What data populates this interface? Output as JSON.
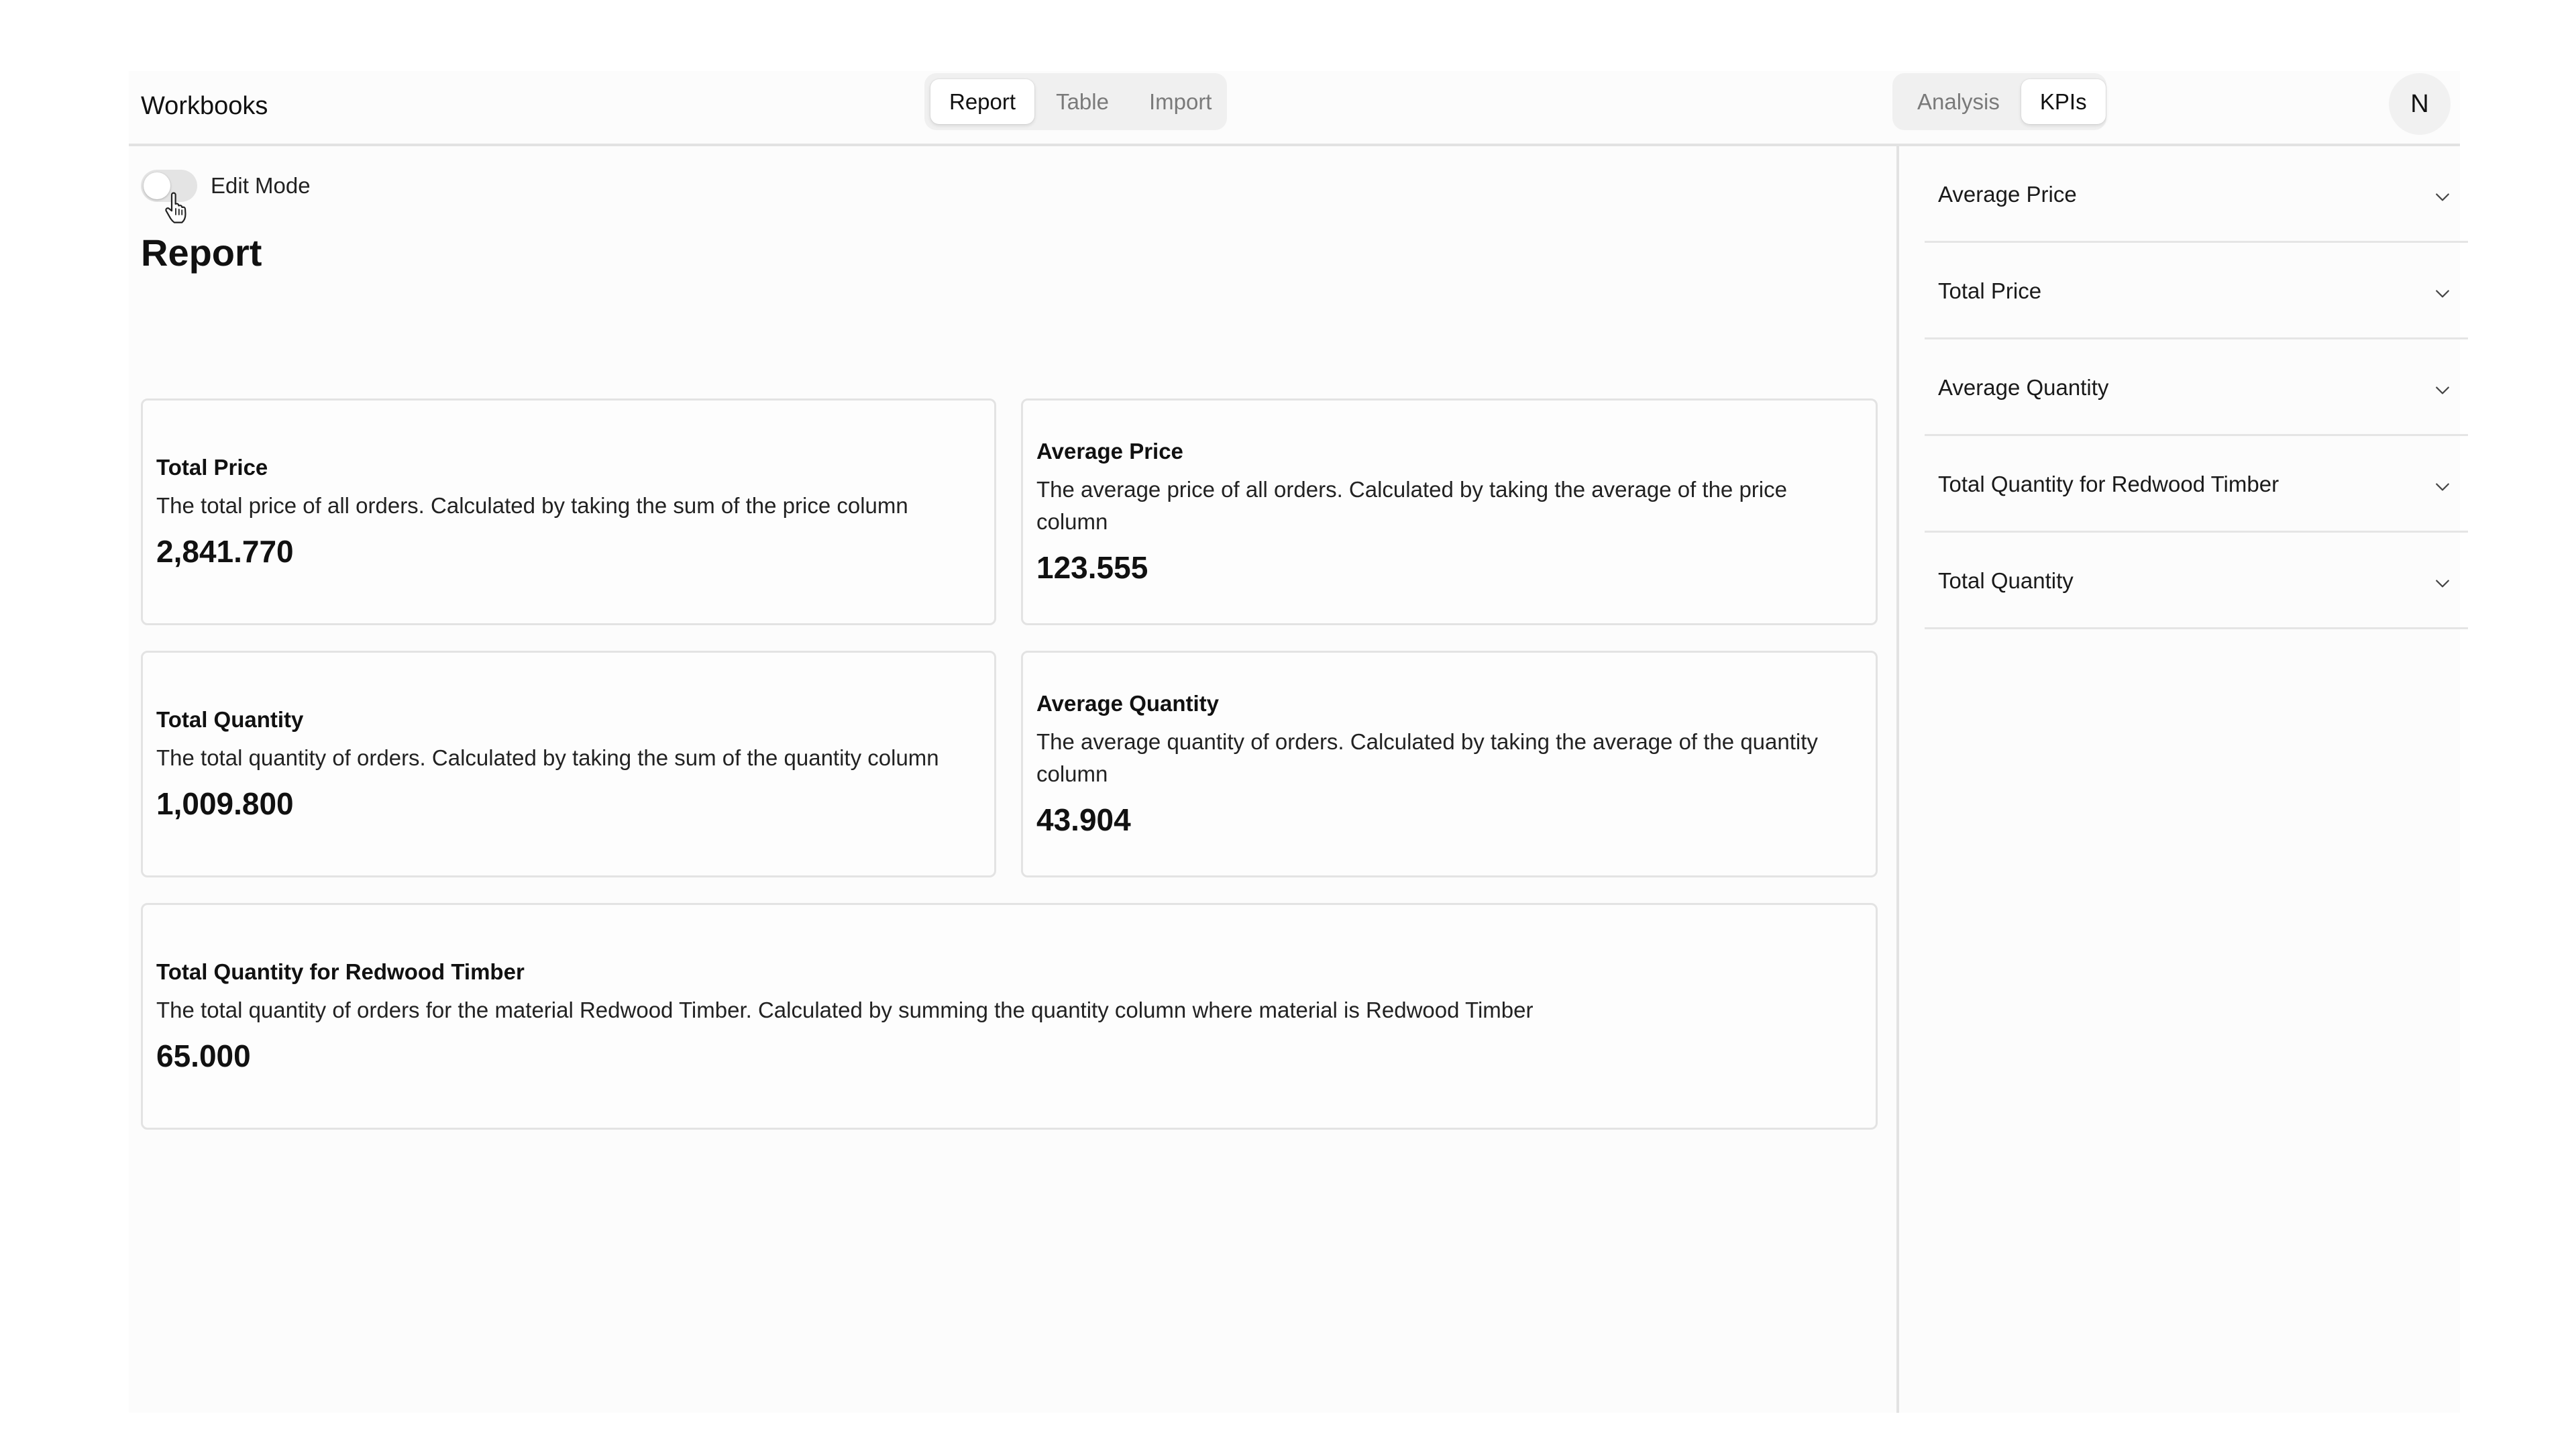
{
  "header": {
    "brand": "Workbooks",
    "main_tabs": [
      {
        "label": "Report",
        "active": true
      },
      {
        "label": "Table",
        "active": false
      },
      {
        "label": "Import",
        "active": false
      }
    ],
    "view_tabs": [
      {
        "label": "Analysis",
        "active": false
      },
      {
        "label": "KPIs",
        "active": true
      }
    ],
    "avatar_initial": "N"
  },
  "main": {
    "edit_mode": {
      "label": "Edit Mode",
      "on": false
    },
    "title": "Report",
    "cards": [
      {
        "title": "Total Price",
        "description": "The total price of all orders. Calculated by taking the sum of the price column",
        "value": "2,841.770"
      },
      {
        "title": "Average Price",
        "description": "The average price of all orders. Calculated by taking the average of the price column",
        "value": "123.555"
      },
      {
        "title": "Total Quantity",
        "description": "The total quantity of orders. Calculated by taking the sum of the quantity column",
        "value": "1,009.800"
      },
      {
        "title": "Average Quantity",
        "description": "The average quantity of orders. Calculated by taking the average of the quantity column",
        "value": "43.904"
      },
      {
        "title": "Total Quantity for Redwood Timber",
        "description": "The total quantity of orders for the material Redwood Timber. Calculated by summing the quantity column where material is Redwood Timber",
        "value": "65.000"
      }
    ]
  },
  "sidebar": {
    "items": [
      {
        "label": "Average Price",
        "icon": "chevron-down-icon"
      },
      {
        "label": "Total Price",
        "icon": "chevron-down-icon"
      },
      {
        "label": "Average Quantity",
        "icon": "chevron-down-icon"
      },
      {
        "label": "Total Quantity for Redwood Timber",
        "icon": "chevron-down-icon"
      },
      {
        "label": "Total Quantity",
        "icon": "chevron-down-icon"
      }
    ]
  },
  "colors": {
    "background": "#fcfcfc",
    "border": "#e3e3e3",
    "segment_bg": "#f0f0f0",
    "active_tab": "#ffffff",
    "inactive_text": "#7a7a7a",
    "text": "#111111"
  }
}
